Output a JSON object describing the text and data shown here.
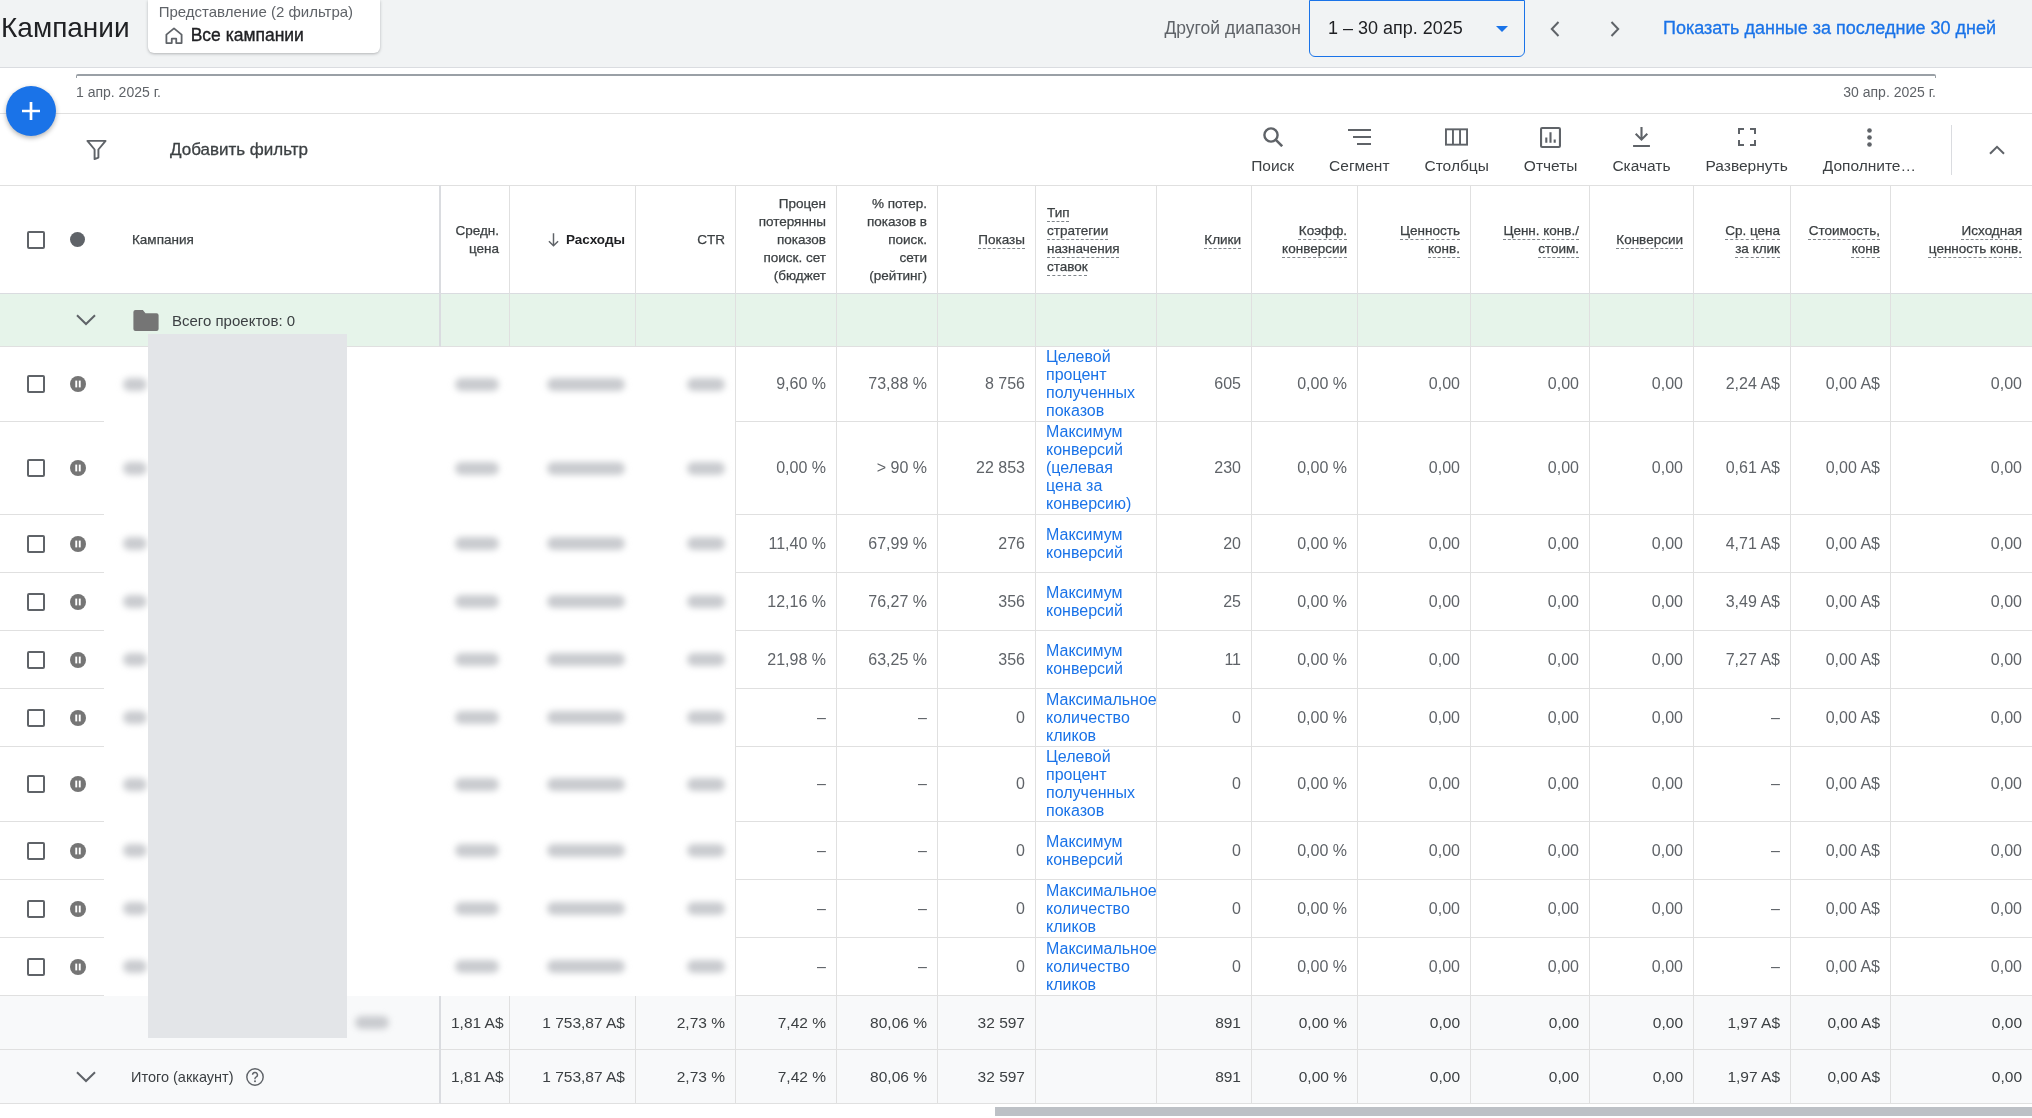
{
  "header": {
    "title": "Кампании",
    "view": {
      "caption": "Представление (2 фильтра)",
      "name": "Все кампании"
    },
    "range_label": "Другой диапазон",
    "date_range": "1 – 30 апр. 2025",
    "recent_link": "Показать данные за последние 30 дней"
  },
  "timeline": {
    "start": "1 апр. 2025 г.",
    "end": "30 апр. 2025 г."
  },
  "toolbar": {
    "filter_label": "Добавить фильтр",
    "actions": [
      {
        "kind": "search",
        "label": "Поиск"
      },
      {
        "kind": "segment",
        "label": "Сегмент"
      },
      {
        "kind": "columns",
        "label": "Столбцы"
      },
      {
        "kind": "reports",
        "label": "Отчеты"
      },
      {
        "kind": "download",
        "label": "Скачать"
      },
      {
        "kind": "expand",
        "label": "Развернуть"
      },
      {
        "kind": "more",
        "label": "Дополните…"
      }
    ]
  },
  "table": {
    "select_all": {
      "checked": false
    },
    "columns": [
      {
        "label": "Кампания",
        "kind": "text",
        "underlined": false,
        "sorted": false
      },
      {
        "label": "Средн. цена",
        "kind": "number",
        "underlined": false,
        "sorted": false
      },
      {
        "label": "Расходы",
        "kind": "number",
        "underlined": false,
        "sorted": true
      },
      {
        "label": "CTR",
        "kind": "number",
        "underlined": false,
        "sorted": false
      },
      {
        "label": "Процен потерянны показов поиск. сет (бюджет",
        "kind": "number",
        "underlined": false,
        "sorted": false
      },
      {
        "label": "% потер. показов в поиск. сети (рейтинг)",
        "kind": "number",
        "underlined": false,
        "sorted": false
      },
      {
        "label": "Показы",
        "kind": "number",
        "underlined": true,
        "sorted": false
      },
      {
        "label": "Тип стратегии назначения ставок",
        "kind": "link",
        "underlined": true,
        "sorted": false
      },
      {
        "label": "Клики",
        "kind": "number",
        "underlined": true,
        "sorted": false
      },
      {
        "label": "Коэфф. конверсии",
        "kind": "number",
        "underlined": true,
        "sorted": false
      },
      {
        "label": "Ценность конв.",
        "kind": "number",
        "underlined": true,
        "sorted": false
      },
      {
        "label": "Ценн. конв./стоим.",
        "kind": "number",
        "underlined": true,
        "sorted": false
      },
      {
        "label": "Конверсии",
        "kind": "number",
        "underlined": true,
        "sorted": false
      },
      {
        "label": "Ср. цена за клик",
        "kind": "number",
        "underlined": true,
        "sorted": false
      },
      {
        "label": "Стоимость, конв",
        "kind": "number",
        "underlined": true,
        "sorted": false
      },
      {
        "label": "Исходная ценность конв.",
        "kind": "number",
        "underlined": true,
        "sorted": false
      }
    ],
    "group": {
      "expanded": true,
      "label": "Всего проектов: 0"
    },
    "rows": [
      {
        "checked": false,
        "paused": true,
        "strategy": "Целевой процент полученных показов",
        "values": [
          "9,60 %",
          "73,88 %",
          "8 756",
          "605",
          "0,00 %",
          "0,00",
          "0,00",
          "0,00",
          "2,24 A$",
          "0,00 A$",
          "0,00"
        ]
      },
      {
        "checked": false,
        "paused": true,
        "strategy": "Максимум конверсий (целевая цена за конверсию)",
        "values": [
          "0,00 %",
          "> 90 %",
          "22 853",
          "230",
          "0,00 %",
          "0,00",
          "0,00",
          "0,00",
          "0,61 A$",
          "0,00 A$",
          "0,00"
        ]
      },
      {
        "checked": false,
        "paused": true,
        "strategy": "Максимум конверсий",
        "values": [
          "11,40 %",
          "67,99 %",
          "276",
          "20",
          "0,00 %",
          "0,00",
          "0,00",
          "0,00",
          "4,71 A$",
          "0,00 A$",
          "0,00"
        ]
      },
      {
        "checked": false,
        "paused": true,
        "strategy": "Максимум конверсий",
        "values": [
          "12,16 %",
          "76,27 %",
          "356",
          "25",
          "0,00 %",
          "0,00",
          "0,00",
          "0,00",
          "3,49 A$",
          "0,00 A$",
          "0,00"
        ]
      },
      {
        "checked": false,
        "paused": true,
        "strategy": "Максимум конверсий",
        "values": [
          "21,98 %",
          "63,25 %",
          "356",
          "11",
          "0,00 %",
          "0,00",
          "0,00",
          "0,00",
          "7,27 A$",
          "0,00 A$",
          "0,00"
        ]
      },
      {
        "checked": false,
        "paused": true,
        "strategy": "Максимальное количество кликов",
        "values": [
          "–",
          "–",
          "0",
          "0",
          "0,00 %",
          "0,00",
          "0,00",
          "0,00",
          "–",
          "0,00 A$",
          "0,00"
        ]
      },
      {
        "checked": false,
        "paused": true,
        "strategy": "Целевой процент полученных показов",
        "values": [
          "–",
          "–",
          "0",
          "0",
          "0,00 %",
          "0,00",
          "0,00",
          "0,00",
          "–",
          "0,00 A$",
          "0,00"
        ]
      },
      {
        "checked": false,
        "paused": true,
        "strategy": "Максимум конверсий",
        "values": [
          "–",
          "–",
          "0",
          "0",
          "0,00 %",
          "0,00",
          "0,00",
          "0,00",
          "–",
          "0,00 A$",
          "0,00"
        ]
      },
      {
        "checked": false,
        "paused": true,
        "strategy": "Максимальное количество кликов",
        "values": [
          "–",
          "–",
          "0",
          "0",
          "0,00 %",
          "0,00",
          "0,00",
          "0,00",
          "–",
          "0,00 A$",
          "0,00"
        ]
      },
      {
        "checked": false,
        "paused": true,
        "strategy": "Максимальное количество кликов",
        "values": [
          "–",
          "–",
          "0",
          "0",
          "0,00 %",
          "0,00",
          "0,00",
          "0,00",
          "–",
          "0,00 A$",
          "0,00"
        ]
      }
    ],
    "totals": [
      {
        "collapsible": false,
        "help_icon": false,
        "values": [
          "1,81 A$",
          "1 753,87 A$",
          "2,73 %",
          "7,42 %",
          "80,06 %",
          "32 597",
          "891",
          "0,00 %",
          "0,00",
          "0,00",
          "0,00",
          "1,97 A$",
          "0,00 A$",
          "0,00"
        ]
      },
      {
        "collapsible": true,
        "help_icon": true,
        "label": "Итого (аккаунт)",
        "values": [
          "1,81 A$",
          "1 753,87 A$",
          "2,73 %",
          "7,42 %",
          "80,06 %",
          "32 597",
          "891",
          "0,00 %",
          "0,00",
          "0,00",
          "0,00",
          "1,97 A$",
          "0,00 A$",
          "0,00"
        ]
      }
    ]
  }
}
